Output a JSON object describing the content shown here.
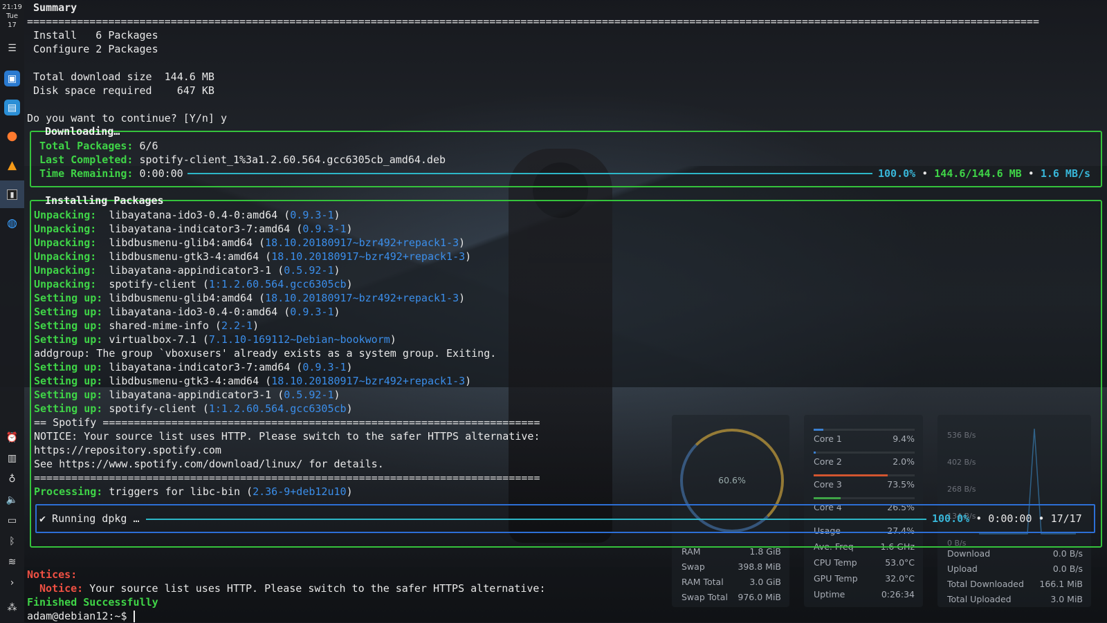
{
  "sidebar": {
    "clock": {
      "time": "21:19",
      "day": "Tue",
      "date": "17"
    },
    "top_icons": [
      "taskbar-settings-icon",
      "store-icon",
      "file-manager-icon",
      "firefox-icon",
      "vlc-icon",
      "terminal-icon",
      "browser-icon"
    ],
    "bottom_icons": [
      "notifications-icon",
      "clipboard-icon",
      "lightbulb-icon",
      "volume-icon",
      "display-icon",
      "bluetooth-icon",
      "wifi-icon",
      "expand-icon",
      "system-menu-icon"
    ]
  },
  "terminal": {
    "summary_title": "Summary",
    "separator": "==================================================================================================================================================================",
    "install_line": "Install   6 Packages",
    "configure_line": "Configure 2 Packages",
    "download_size_line": "Total download size  144.6 MB",
    "disk_space_line": "Disk space required    647 KB",
    "prompt_question": "Do you want to continue? [Y/n] y",
    "downloading": {
      "title": "Downloading…",
      "total_packages_label": "Total Packages:",
      "total_packages_value": "6/6",
      "last_completed_label": "Last Completed:",
      "last_completed_value": "spotify-client_1%3a1.2.60.564.gcc6305cb_amd64.deb",
      "time_remaining_label": "Time Remaining:",
      "time_remaining_value": "0:00:00",
      "percent": "100.0%",
      "bullet": "•",
      "size": "144.6/144.6 MB",
      "speed": "1.6 MB/s",
      "progress": 1.0
    },
    "installing": {
      "title": "Installing Packages",
      "lines": [
        {
          "label": "Unpacking:",
          "pkg": "  libayatana-ido3-0.4-0:amd64 (",
          "ver": "0.9.3-1",
          "end": ")"
        },
        {
          "label": "Unpacking:",
          "pkg": "  libayatana-indicator3-7:amd64 (",
          "ver": "0.9.3-1",
          "end": ")"
        },
        {
          "label": "Unpacking:",
          "pkg": "  libdbusmenu-glib4:amd64 (",
          "ver": "18.10.20180917~bzr492+repack1-3",
          "end": ")"
        },
        {
          "label": "Unpacking:",
          "pkg": "  libdbusmenu-gtk3-4:amd64 (",
          "ver": "18.10.20180917~bzr492+repack1-3",
          "end": ")"
        },
        {
          "label": "Unpacking:",
          "pkg": "  libayatana-appindicator3-1 (",
          "ver": "0.5.92-1",
          "end": ")"
        },
        {
          "label": "Unpacking:",
          "pkg": "  spotify-client (",
          "ver": "1:1.2.60.564.gcc6305cb",
          "end": ")"
        },
        {
          "label": "Setting up:",
          "pkg": " libdbusmenu-glib4:amd64 (",
          "ver": "18.10.20180917~bzr492+repack1-3",
          "end": ")"
        },
        {
          "label": "Setting up:",
          "pkg": " libayatana-ido3-0.4-0:amd64 (",
          "ver": "0.9.3-1",
          "end": ")"
        },
        {
          "label": "Setting up:",
          "pkg": " shared-mime-info (",
          "ver": "2.2-1",
          "end": ")"
        },
        {
          "label": "Setting up:",
          "pkg": " virtualbox-7.1 (",
          "ver": "7.1.10-169112~Debian~bookworm",
          "end": ")"
        },
        {
          "label": "",
          "pkg": "addgroup: The group `vboxusers' already exists as a system group. Exiting.",
          "ver": "",
          "end": ""
        },
        {
          "label": "Setting up:",
          "pkg": " libayatana-indicator3-7:amd64 (",
          "ver": "0.9.3-1",
          "end": ")"
        },
        {
          "label": "Setting up:",
          "pkg": " libdbusmenu-gtk3-4:amd64 (",
          "ver": "18.10.20180917~bzr492+repack1-3",
          "end": ")"
        },
        {
          "label": "Setting up:",
          "pkg": " libayatana-appindicator3-1 (",
          "ver": "0.5.92-1",
          "end": ")"
        },
        {
          "label": "Setting up:",
          "pkg": " spotify-client (",
          "ver": "1:1.2.60.564.gcc6305cb",
          "end": ")"
        },
        {
          "label": "",
          "pkg": "== Spotify ======================================================================",
          "ver": "",
          "end": ""
        },
        {
          "label": "",
          "pkg": "NOTICE: Your source list uses HTTP. Please switch to the safer HTTPS alternative:",
          "ver": "",
          "end": ""
        },
        {
          "label": "",
          "pkg": "https://repository.spotify.com",
          "ver": "",
          "end": ""
        },
        {
          "label": "",
          "pkg": "See https://www.spotify.com/download/linux/ for details.",
          "ver": "",
          "end": ""
        },
        {
          "label": "",
          "pkg": "=================================================================================",
          "ver": "",
          "end": ""
        },
        {
          "label": "Processing:",
          "pkg": " triggers for libc-bin (",
          "ver": "2.36-9+deb12u10",
          "end": ")"
        }
      ]
    },
    "running": {
      "label": "✔ Running dpkg …",
      "percent": "100.0%",
      "bullet": "•",
      "time": "0:00:00",
      "count": "17/17",
      "progress": 1.0
    },
    "notices_title": "Notices:",
    "notice_label": "Notice:",
    "notice_text": " Your source list uses HTTP. Please switch to the safer HTTPS alternative:",
    "finished": "Finished Successfully",
    "shell_prompt": "adam@debian12:~$ "
  },
  "monitor": {
    "memory": {
      "gauge_value": "60.6%",
      "rows": [
        {
          "label": "RAM",
          "value": "1.8 GiB"
        },
        {
          "label": "Swap",
          "value": "398.8 MiB"
        },
        {
          "label": "RAM Total",
          "value": "3.0 GiB"
        },
        {
          "label": "Swap Total",
          "value": "976.0 MiB"
        }
      ]
    },
    "cpu": {
      "cores": [
        {
          "label": "Core 1",
          "value": "9.4%",
          "level": 0.094
        },
        {
          "label": "Core 2",
          "value": "2.0%",
          "level": 0.02
        },
        {
          "label": "Core 3",
          "value": "73.5%",
          "level": 0.735
        },
        {
          "label": "Core 4",
          "value": "26.5%",
          "level": 0.265
        }
      ],
      "rows": [
        {
          "label": "Usage",
          "value": "27.4%"
        },
        {
          "label": "Ave. Freq",
          "value": "1.6 GHz"
        },
        {
          "label": "CPU Temp",
          "value": "53.0°C"
        },
        {
          "label": "GPU Temp",
          "value": "32.0°C"
        },
        {
          "label": "Uptime",
          "value": "0:26:34"
        }
      ]
    },
    "network": {
      "ticks": [
        "536 B/s",
        "402 B/s",
        "268 B/s",
        "134 B/s",
        "0 B/s"
      ],
      "rows": [
        {
          "label": "Download",
          "value": "0.0 B/s"
        },
        {
          "label": "Upload",
          "value": "0.0 B/s"
        },
        {
          "label": "Total Downloaded",
          "value": "166.1 MiB"
        },
        {
          "label": "Total Uploaded",
          "value": "3.0 MiB"
        }
      ]
    }
  }
}
